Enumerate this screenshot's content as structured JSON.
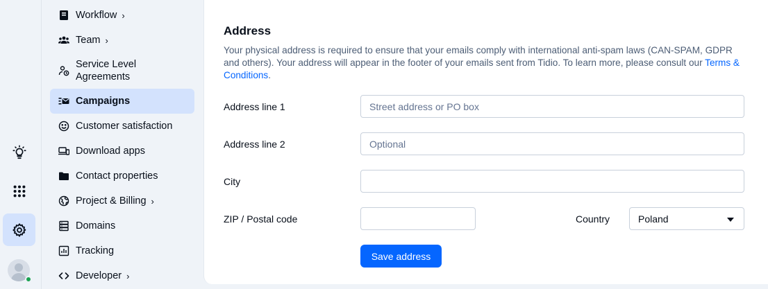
{
  "rail": {
    "items": [
      {
        "icon": "lightbulb-icon"
      },
      {
        "icon": "apps-grid-icon"
      },
      {
        "icon": "settings-gear-icon",
        "active": true
      }
    ],
    "user_status": "online"
  },
  "nav": {
    "items": [
      {
        "label": "Workflow",
        "icon": "workflow-icon",
        "chevron": "›"
      },
      {
        "label": "Team",
        "icon": "team-icon",
        "chevron": "›"
      },
      {
        "label": "Service Level Agreements",
        "icon": "sla-icon"
      },
      {
        "label": "Campaigns",
        "icon": "campaigns-icon",
        "active": true
      },
      {
        "label": "Customer satisfaction",
        "icon": "smiley-icon"
      },
      {
        "label": "Download apps",
        "icon": "devices-icon"
      },
      {
        "label": "Contact properties",
        "icon": "folder-icon"
      },
      {
        "label": "Project & Billing",
        "icon": "globe-icon",
        "chevron": "›"
      },
      {
        "label": "Domains",
        "icon": "domains-icon"
      },
      {
        "label": "Tracking",
        "icon": "chart-icon"
      },
      {
        "label": "Developer",
        "icon": "code-icon",
        "chevron": "›"
      }
    ]
  },
  "address": {
    "title": "Address",
    "description": "Your physical address is required to ensure that your emails comply with international anti-spam laws (CAN-SPAM, GDPR and others). Your address will appear in the footer of your emails sent from Tidio. To learn more, please consult our ",
    "terms_link": "Terms & Conditions",
    "description_end": ".",
    "line1_label": "Address line 1",
    "line1_placeholder": "Street address or PO box",
    "line1_value": "",
    "line2_label": "Address line 2",
    "line2_placeholder": "Optional",
    "line2_value": "",
    "city_label": "City",
    "city_value": "",
    "zip_label": "ZIP / Postal code",
    "zip_value": "",
    "country_label": "Country",
    "country_value": "Poland",
    "save_label": "Save address"
  },
  "colors": {
    "accent": "#0566ff",
    "active_bg": "#d3e2fd",
    "sidebar_bg": "#eff3f8",
    "online": "#1aa251"
  }
}
